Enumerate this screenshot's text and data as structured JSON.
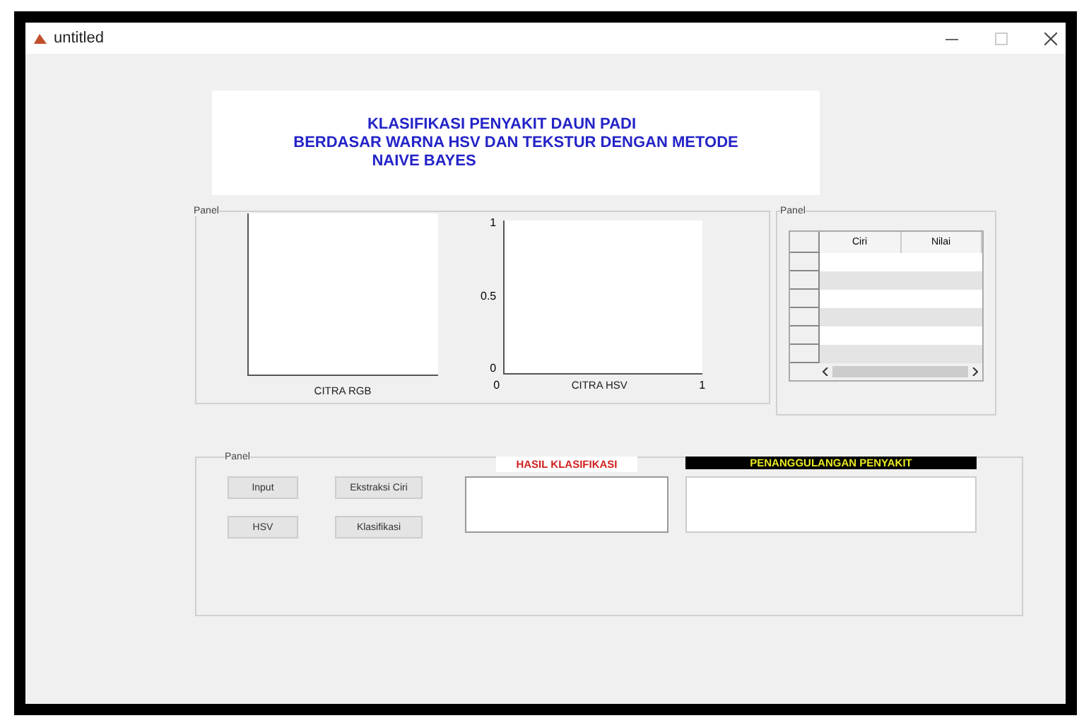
{
  "window": {
    "title": "untitled"
  },
  "heading": {
    "lines": [
      "KLASIFIKASI PENYAKIT DAUN PADI",
      "BERDASAR WARNA HSV DAN TEKSTUR DENGAN METODE",
      "NAIVE BAYES"
    ]
  },
  "image_panel": {
    "title": "Panel",
    "axes": [
      {
        "kind": "image",
        "xlabel": "CITRA RGB"
      },
      {
        "kind": "plot",
        "xlabel": "CITRA HSV",
        "yticks": [
          "1",
          "0.5",
          "0"
        ],
        "xticks": [
          "0",
          "1"
        ]
      }
    ]
  },
  "feature_panel": {
    "title": "Panel",
    "table": {
      "columns": [
        "Ciri",
        "Nilai"
      ]
    }
  },
  "control_panel": {
    "title": "Panel",
    "buttons": [
      "Input",
      "Ekstraksi Ciri",
      "HSV",
      "Klasifikasi"
    ],
    "result": {
      "label": "HASIL KLASIFIKASI"
    },
    "treatment": {
      "label": "PENANGGULANGAN PENYAKIT"
    }
  }
}
